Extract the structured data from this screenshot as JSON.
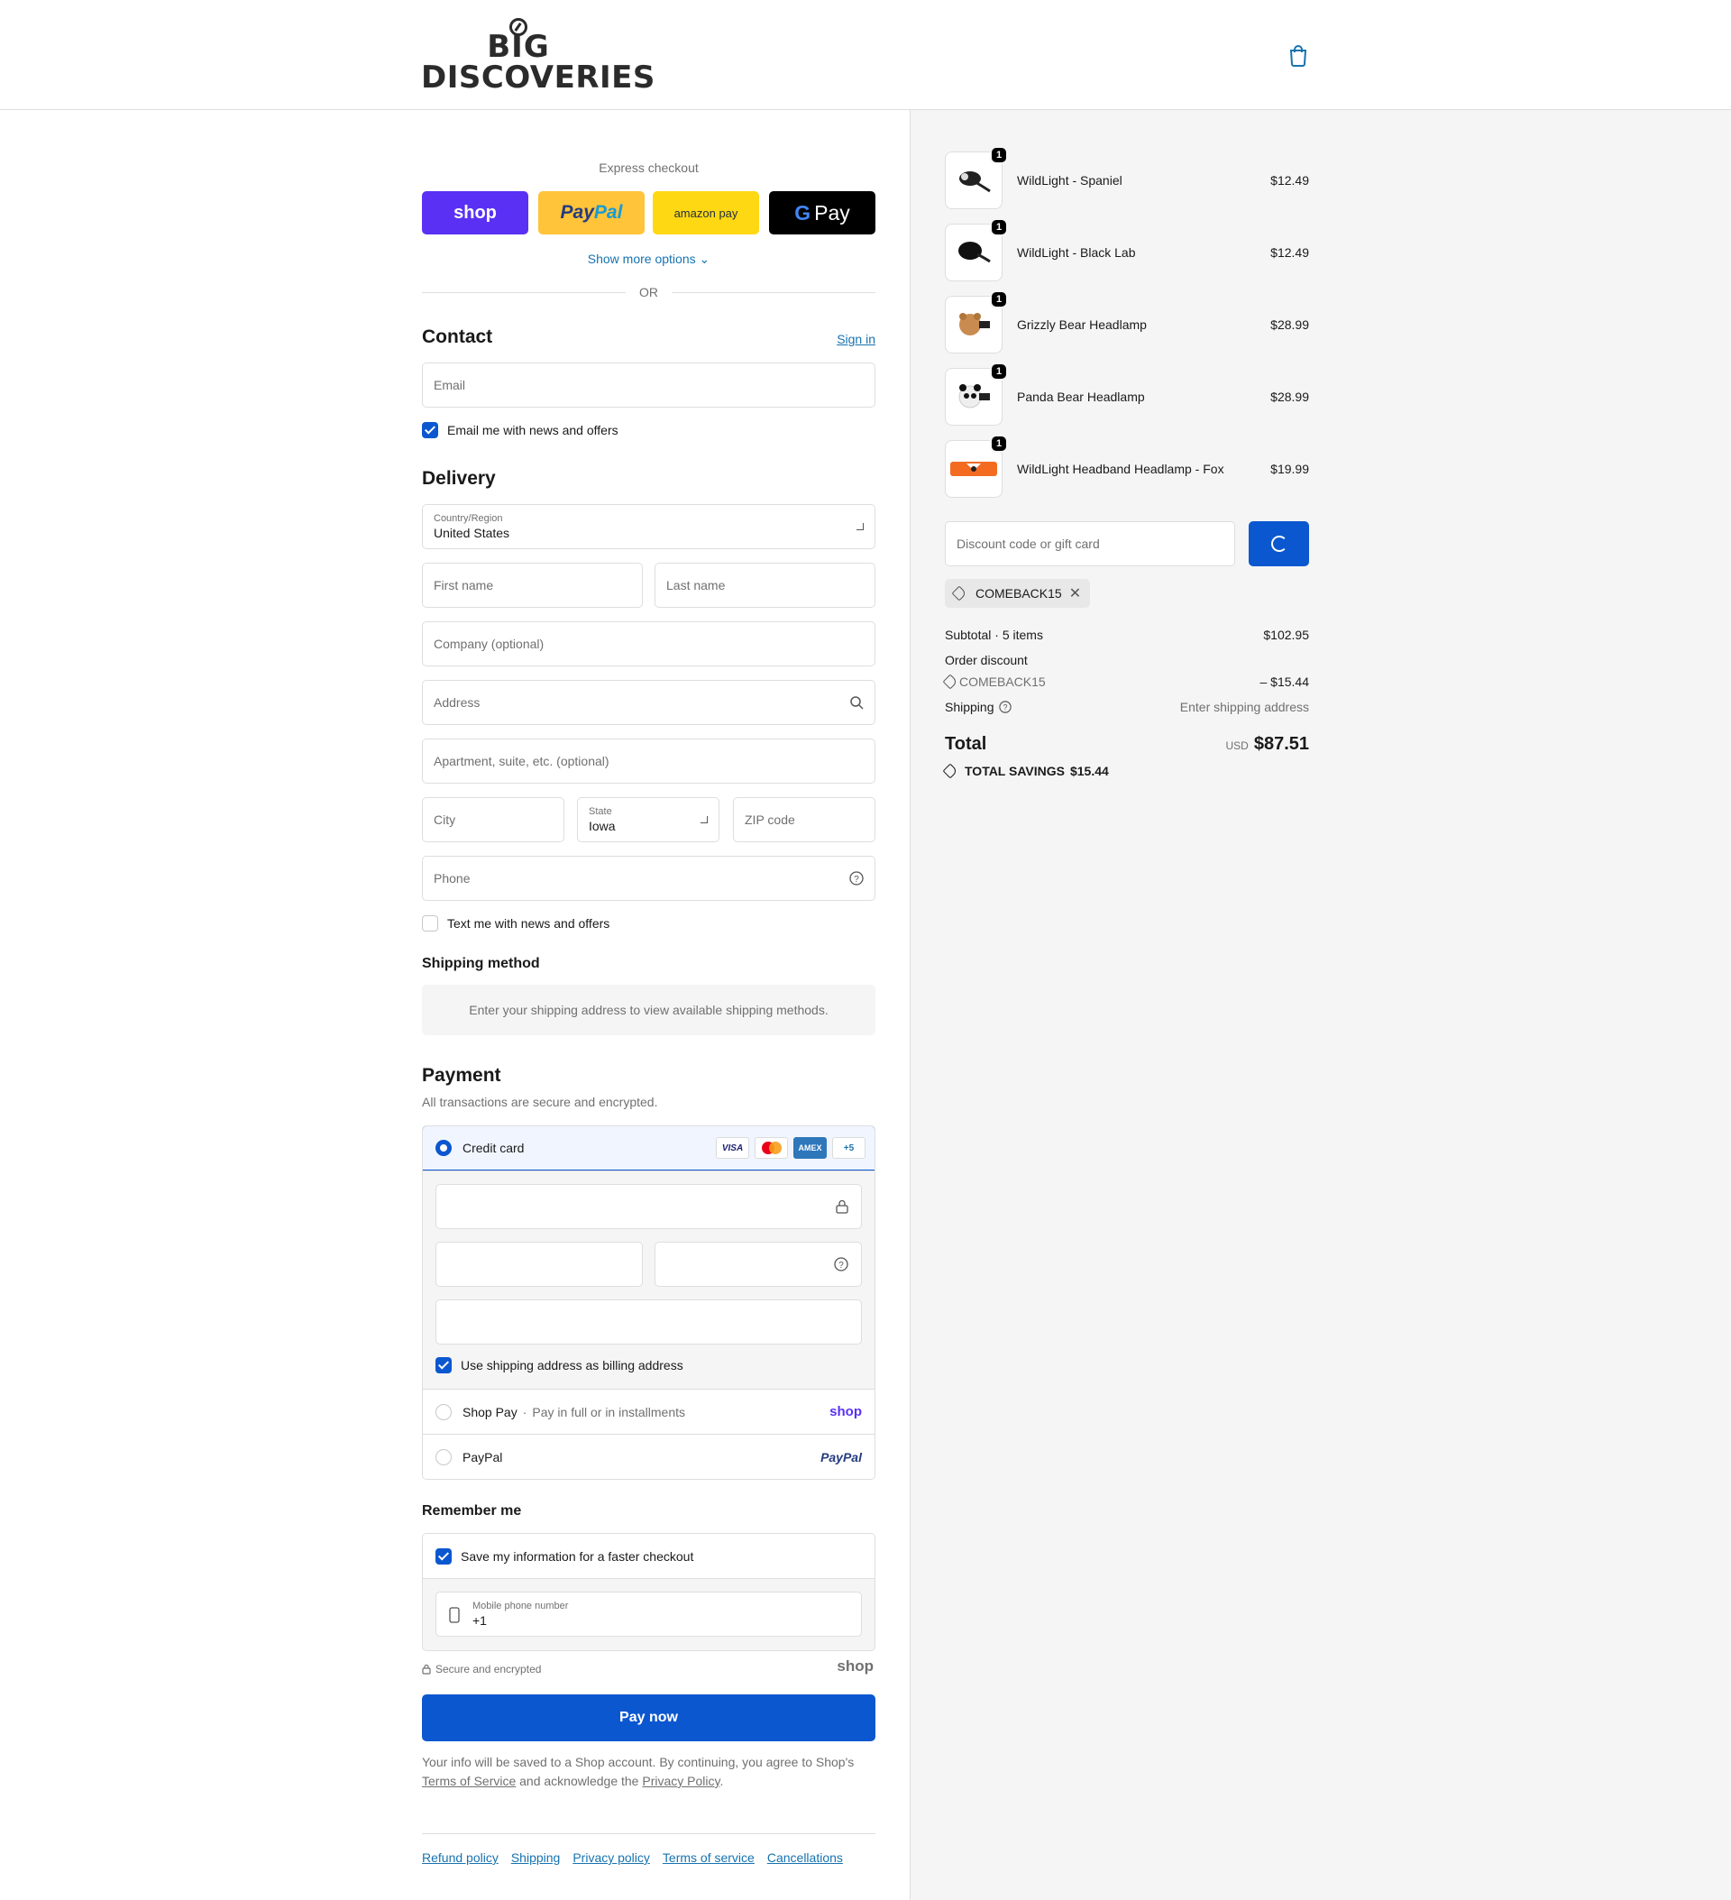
{
  "header": {
    "brand_line1": "BIG",
    "brand_line2": "DISCOVERIES"
  },
  "express": {
    "title": "Express checkout",
    "shop_label": "shop",
    "paypal_label1": "Pay",
    "paypal_label2": "Pal",
    "amazon_label": "amazon pay",
    "gpay_g": "G",
    "gpay_label": "Pay",
    "more_options": "Show more options ⌄",
    "or": "OR"
  },
  "contact": {
    "title": "Contact",
    "sign_in": "Sign in",
    "email_placeholder": "Email",
    "email_optin": "Email me with news and offers"
  },
  "delivery": {
    "title": "Delivery",
    "country_label": "Country/Region",
    "country_value": "United States",
    "first_name": "First name",
    "last_name": "Last name",
    "company": "Company (optional)",
    "address": "Address",
    "apartment": "Apartment, suite, etc. (optional)",
    "city": "City",
    "state_label": "State",
    "state_value": "Iowa",
    "zip": "ZIP code",
    "phone": "Phone",
    "text_optin": "Text me with news and offers"
  },
  "shipping_method": {
    "title": "Shipping method",
    "info": "Enter your shipping address to view available shipping methods."
  },
  "payment": {
    "title": "Payment",
    "subtitle": "All transactions are secure and encrypted.",
    "credit_card": "Credit card",
    "card_icons": [
      "VISA",
      "AMEX",
      "+5"
    ],
    "billing_same": "Use shipping address as billing address",
    "shop_pay": "Shop Pay",
    "shop_pay_note": "Pay in full or in installments",
    "shop_pay_brand": "shop",
    "paypal": "PayPal",
    "paypal_brand": "PayPal"
  },
  "remember": {
    "title": "Remember me",
    "save_info": "Save my information for a faster checkout",
    "mobile_label": "Mobile phone number",
    "mobile_value": "+1"
  },
  "secure": {
    "text": "Secure and encrypted",
    "brand": "shop"
  },
  "pay_now": "Pay now",
  "legal": {
    "line1": "Your info will be saved to a Shop account. By continuing, you agree to Shop's",
    "terms": "Terms of Service",
    "mid": "and acknowledge the",
    "privacy": "Privacy Policy",
    "end": "."
  },
  "footer": [
    "Refund policy",
    "Shipping",
    "Privacy policy",
    "Terms of service",
    "Cancellations"
  ],
  "summary": {
    "items": [
      {
        "qty": "1",
        "name": "WildLight - Spaniel",
        "price": "$12.49"
      },
      {
        "qty": "1",
        "name": "WildLight - Black Lab",
        "price": "$12.49"
      },
      {
        "qty": "1",
        "name": "Grizzly Bear Headlamp",
        "price": "$28.99"
      },
      {
        "qty": "1",
        "name": "Panda Bear Headlamp",
        "price": "$28.99"
      },
      {
        "qty": "1",
        "name": "WildLight Headband Headlamp - Fox",
        "price": "$19.99"
      }
    ],
    "discount_placeholder": "Discount code or gift card",
    "applied_code": "COMEBACK15",
    "subtotal_label": "Subtotal · 5 items",
    "subtotal": "$102.95",
    "order_discount_label": "Order discount",
    "discount_code": "COMEBACK15",
    "discount_amount": "– $15.44",
    "shipping_label": "Shipping",
    "shipping_value": "Enter shipping address",
    "total_label": "Total",
    "currency": "USD",
    "total": "$87.51",
    "savings_label": "TOTAL SAVINGS",
    "savings": "$15.44"
  }
}
